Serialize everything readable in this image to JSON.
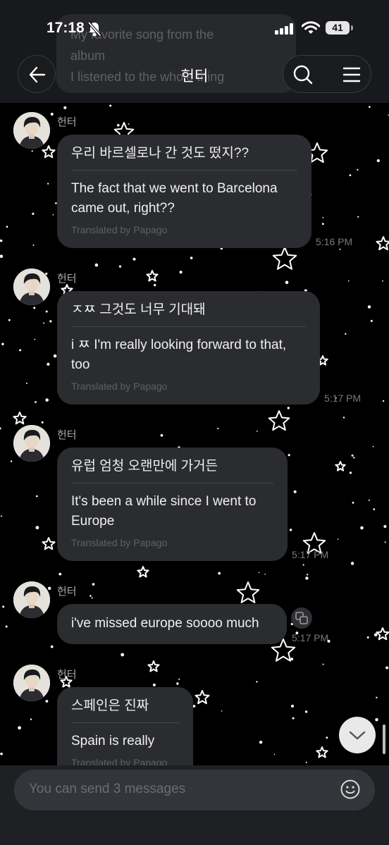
{
  "status_bar": {
    "time": "17:18",
    "battery": "41"
  },
  "header": {
    "title": "헌터",
    "background_ghost_text": [
      "My favorite song from the",
      "album",
      "I listened to the whole thing"
    ]
  },
  "messages": [
    {
      "sender": "헌터",
      "original": "우리 바르셀로나 간 것도 떴지??",
      "translation": "The fact that we went to Barcelona came out, right??",
      "credit": "Translated by Papago",
      "time": "5:16 PM"
    },
    {
      "sender": "헌터",
      "original": "ㅈㅉ 그것도 너무 기대돼",
      "translation": "i ㅉ I'm really looking forward to that, too",
      "credit": "Translated by Papago",
      "time": "5:17 PM"
    },
    {
      "sender": "헌터",
      "original": "유럽 엄청 오랜만에 가거든",
      "translation": "It's been a while since I went to Europe",
      "credit": "Translated by Papago",
      "time": "5:17 PM"
    },
    {
      "sender": "헌터",
      "text": "i've missed europe soooo much",
      "time": "5:17 PM"
    },
    {
      "sender": "헌터",
      "original": "스페인은 진짜",
      "translation": "Spain is really",
      "credit": "Translated by Papago"
    }
  ],
  "composer": {
    "placeholder": "You can send 3 messages"
  },
  "icons": [
    "bell-slash-icon",
    "signal-icon",
    "wifi-icon",
    "back-arrow-icon",
    "search-icon",
    "menu-icon",
    "translate-icon",
    "chevron-down-icon",
    "emoji-icon"
  ]
}
